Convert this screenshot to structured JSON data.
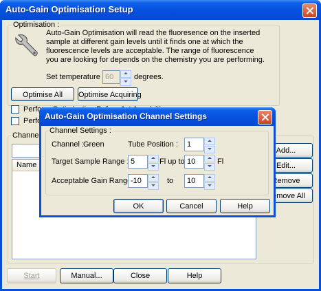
{
  "main_window": {
    "title": "Auto-Gain Optimisation Setup",
    "optimisation_group": "Optimisation :",
    "description": "Auto-Gain Optimisation will read the fluoresence on the inserted sample at different gain levels until it finds one at which the fluorescence levels are acceptable. The range of fluorescence you are looking for depends on the chemistry you are performing.",
    "temperature": {
      "label_before": "Set temperature to",
      "value": "60",
      "label_after": "degrees."
    },
    "optimise_all": "Optimise All",
    "optimise_acquiring": "Optimise Acquiring",
    "checkbox1_label": "Perform Optimisation Before 1st Acquisition",
    "checkbox2_label": "Perform",
    "channel_group": "Channel S",
    "table_header_name": "Name",
    "side_buttons": {
      "add": "Add...",
      "edit": "Edit...",
      "remove": "Remove",
      "remove_all": "Remove All"
    },
    "footer": {
      "start": "Start",
      "manual": "Manual...",
      "close": "Close",
      "help": "Help"
    }
  },
  "dialog": {
    "title": "Auto-Gain Optimisation Channel Settings",
    "group_label": "Channel Settings :",
    "channel_label": "Channel :",
    "channel_value": "Green",
    "tube_position_label": "Tube Position :",
    "tube_position_value": "1",
    "target_range_label": "Target Sample Range :",
    "target_min": "5",
    "target_mid_label": "Fl up to",
    "target_max": "10",
    "target_unit": "Fl",
    "gain_range_label": "Acceptable Gain Range:",
    "gain_min": "-10",
    "gain_to": "to",
    "gain_max": "10",
    "ok": "OK",
    "cancel": "Cancel",
    "help": "Help"
  }
}
